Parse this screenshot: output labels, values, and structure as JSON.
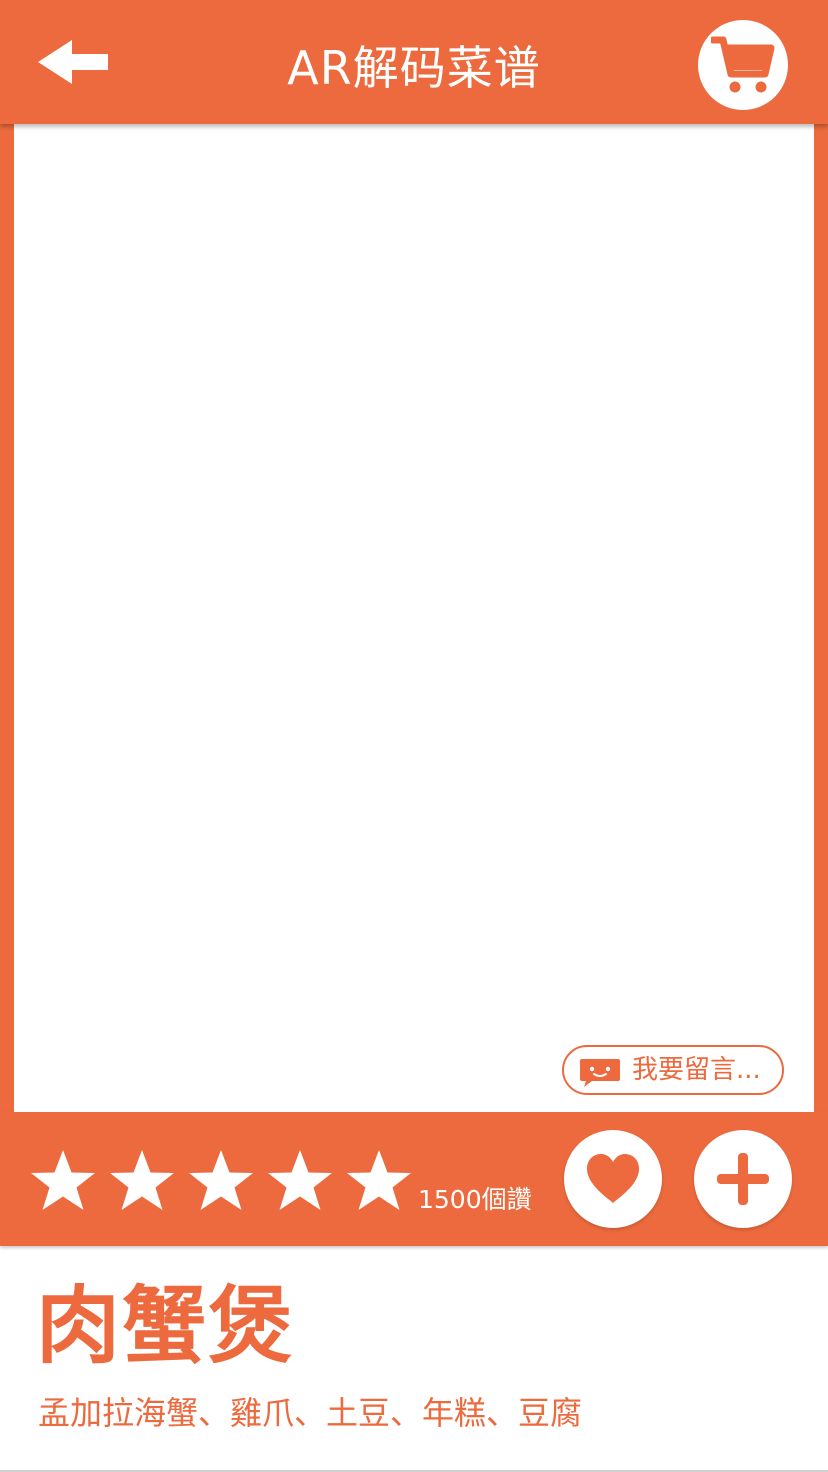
{
  "header": {
    "title": "AR解码菜谱",
    "back_icon": "arrow-left-icon",
    "cart_icon": "shopping-cart-icon"
  },
  "comment": {
    "label": "我要留言...",
    "icon": "chat-bubble-icon"
  },
  "rating": {
    "stars": 5,
    "max": 5,
    "likes_text": "1500個讚"
  },
  "actions": {
    "like_icon": "heart-icon",
    "add_icon": "plus-icon"
  },
  "dish": {
    "name": "肉蟹煲",
    "ingredients": "孟加拉海蟹、雞爪、土豆、年糕、豆腐"
  },
  "colors": {
    "accent": "#ec6a3d",
    "background": "#ffffff"
  }
}
